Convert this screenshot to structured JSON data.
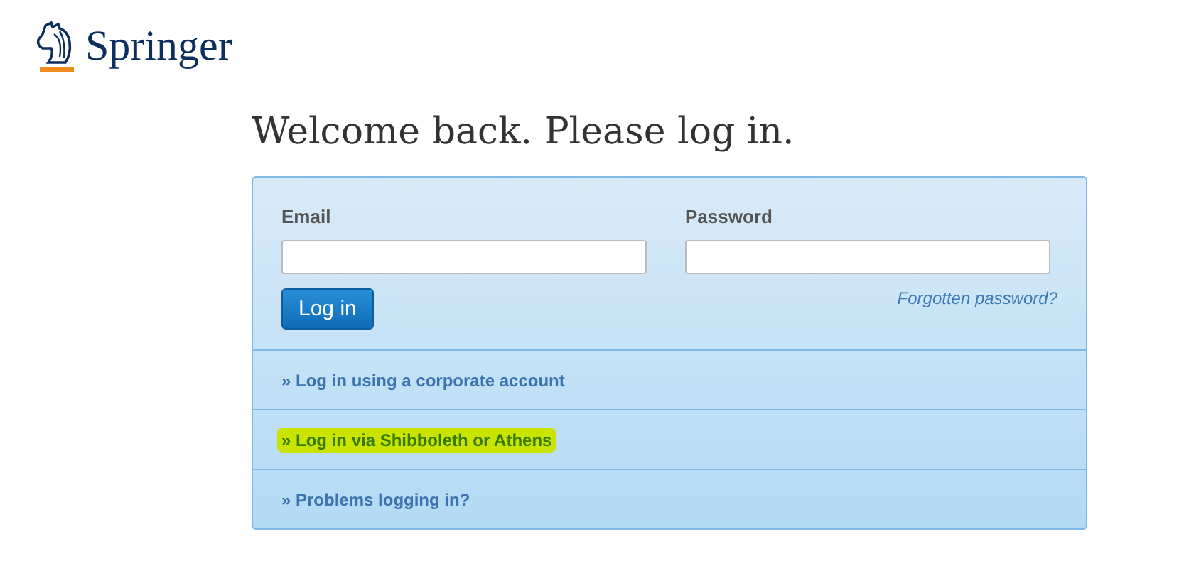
{
  "logo": {
    "text": "Springer"
  },
  "heading": "Welcome back. Please log in.",
  "form": {
    "fields": [
      {
        "label": "Email"
      },
      {
        "label": "Password"
      }
    ],
    "submit": "Log in",
    "forgot_link": "Forgotten password?"
  },
  "links": [
    {
      "text": "» Log in using a corporate account",
      "highlighted": false
    },
    {
      "text": "» Log in via Shibboleth or Athens",
      "highlighted": true
    },
    {
      "text": "» Problems logging in?",
      "highlighted": false
    }
  ]
}
